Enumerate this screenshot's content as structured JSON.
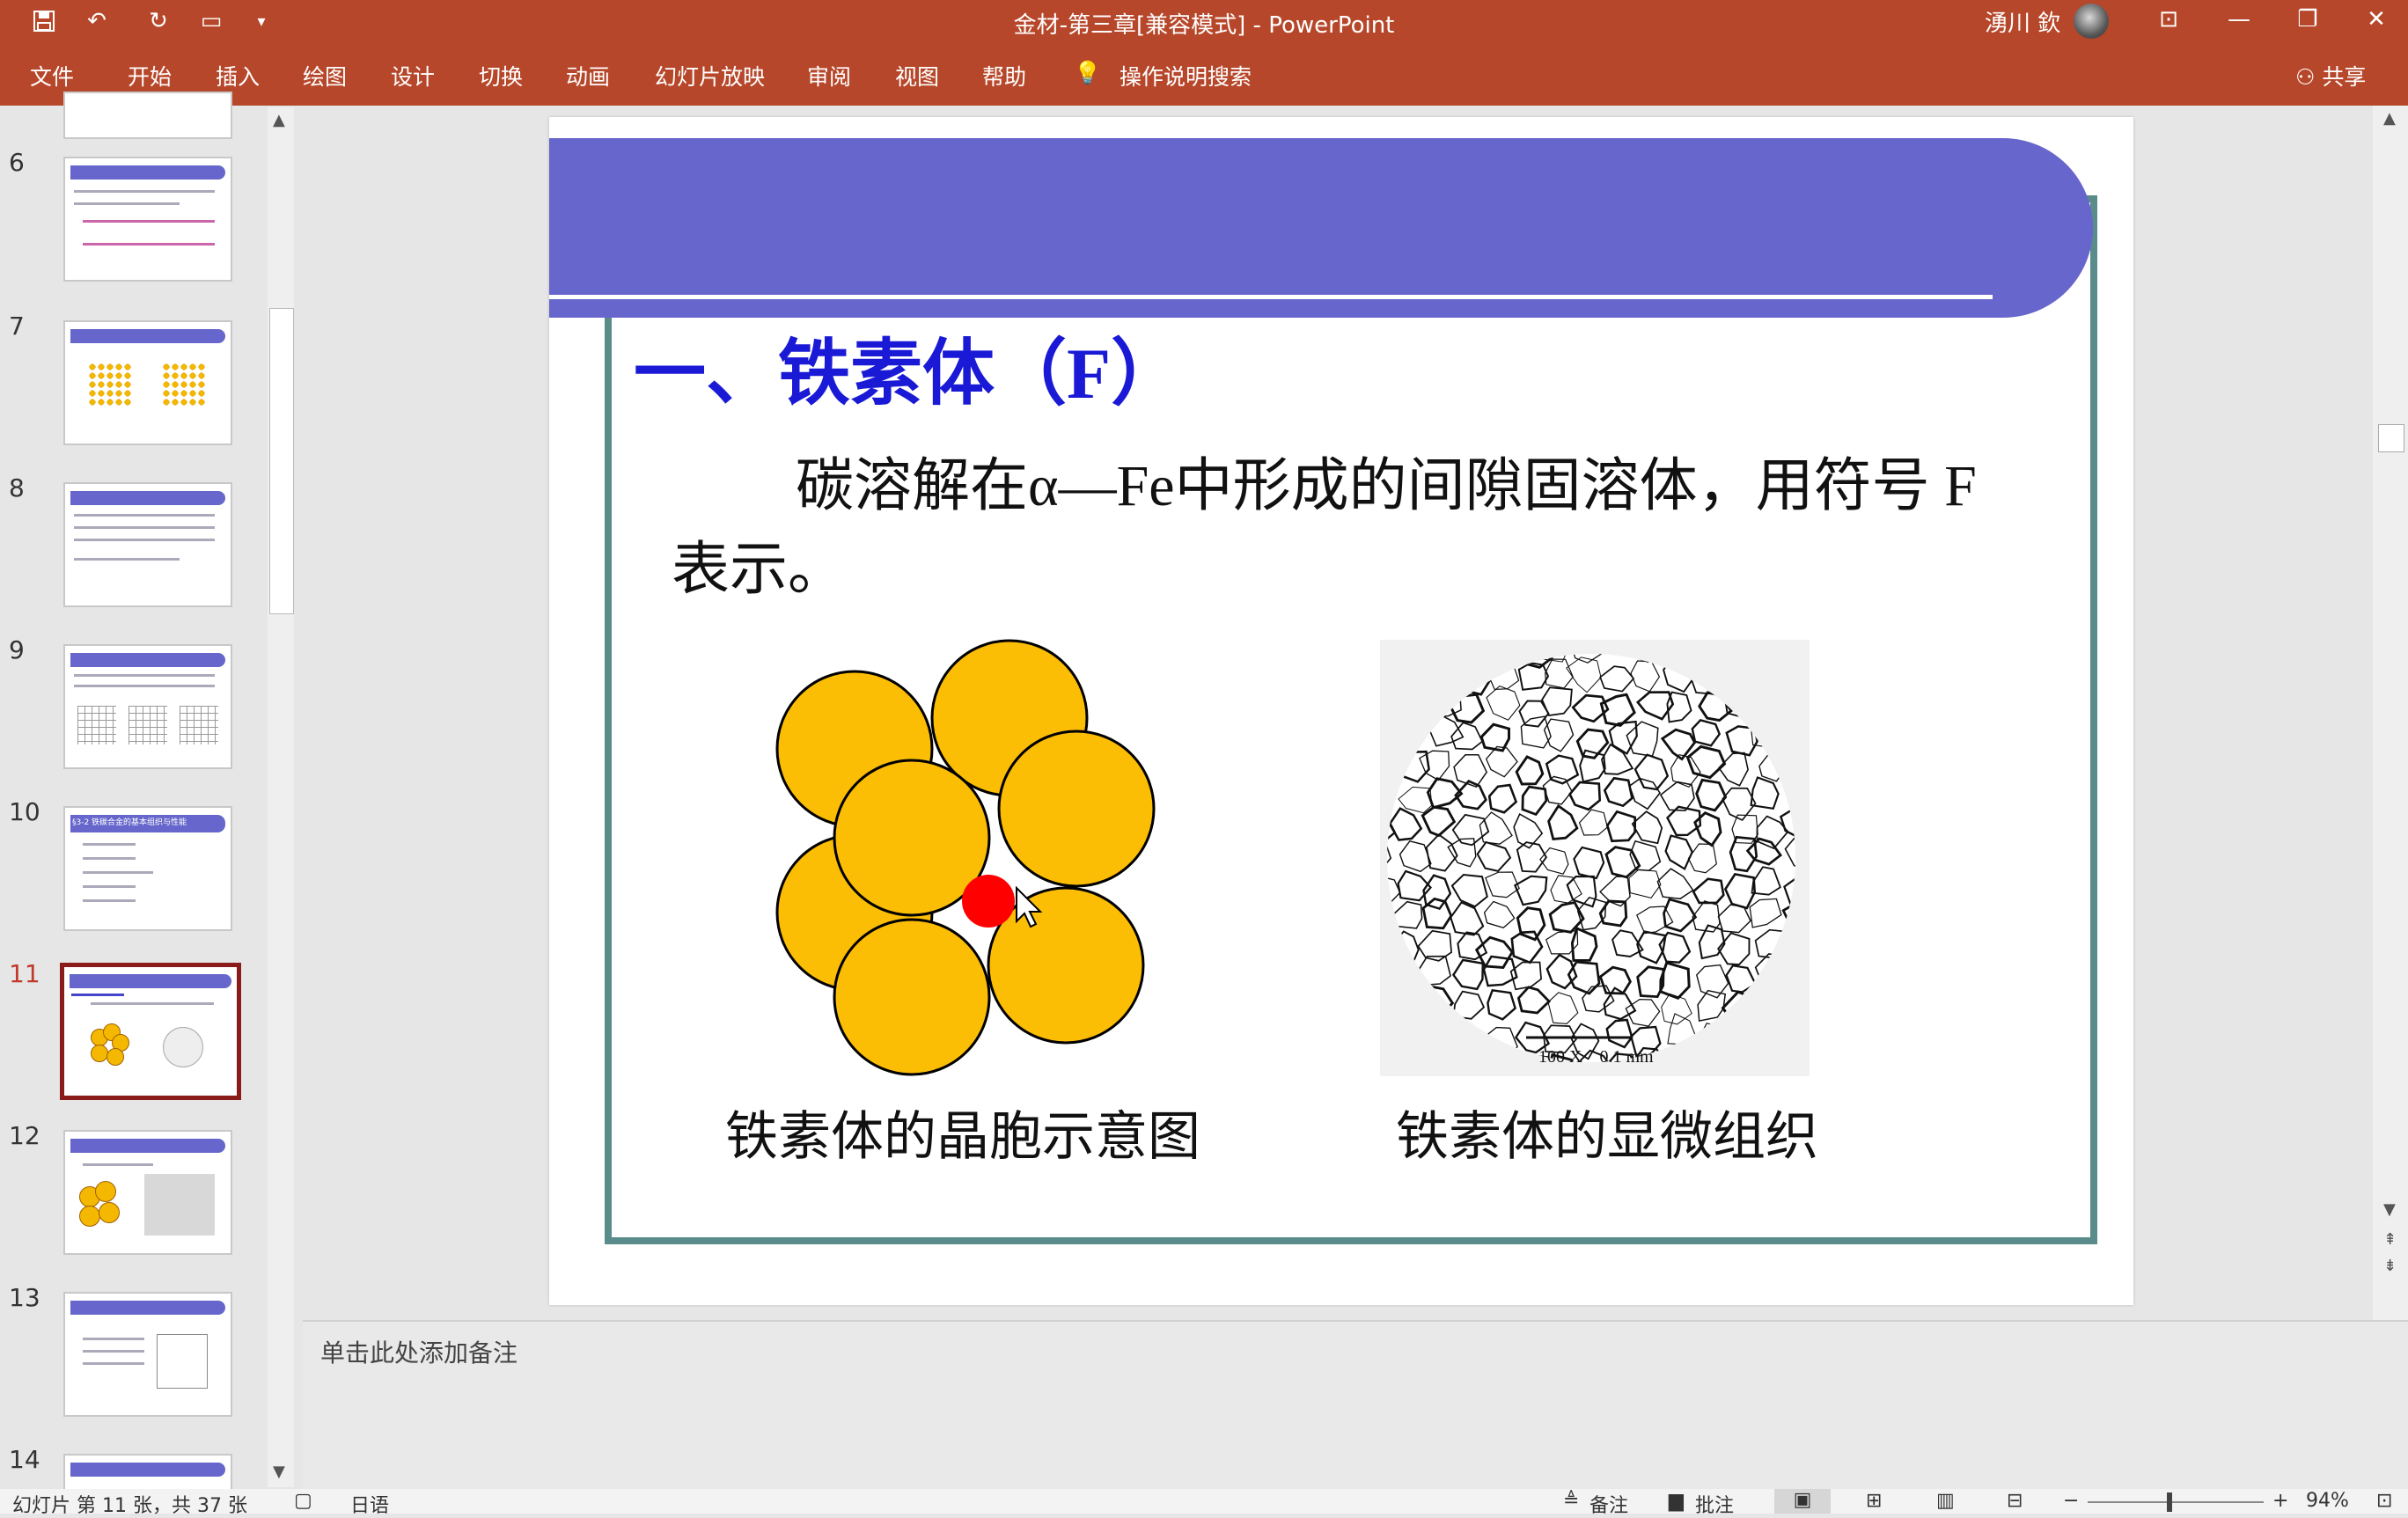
{
  "window": {
    "title": "金材-第三章[兼容模式] - PowerPoint",
    "user": "湧川 欽"
  },
  "ribbon_tabs": [
    "文件",
    "开始",
    "插入",
    "绘图",
    "设计",
    "切换",
    "动画",
    "幻灯片放映",
    "审阅",
    "视图",
    "帮助"
  ],
  "search_label": "操作说明搜索",
  "share_label": "共享",
  "slide_numbers": [
    "6",
    "7",
    "8",
    "9",
    "10",
    "11",
    "12",
    "13",
    "14"
  ],
  "active_slide": "11",
  "thumb_texts": {
    "t10": "§3-2 铁碳合金的基本组织与性能"
  },
  "slide": {
    "heading": "一、铁素体（F）",
    "body_line1": "碳溶解在α—Fe中形成的间隙固溶体，用符号 F",
    "body_line2": "表示。",
    "caption_left": "铁素体的晶胞示意图",
    "caption_right": "铁素体的显微组织",
    "micro_label": "100 X    0.1 mm"
  },
  "notes_placeholder": "单击此处添加备注",
  "status": {
    "slide_info": "幻灯片 第 11 张，共 37 张",
    "language": "日语",
    "notes_btn": "备注",
    "comments_btn": "批注",
    "zoom": "94%"
  },
  "colors": {
    "ribbon": "#b7472a",
    "slide_bar": "#6666cc",
    "frame": "#5b8c8c",
    "heading": "#1a1ad6",
    "atom": "#fcbd05",
    "carbon": "#ff0000"
  }
}
